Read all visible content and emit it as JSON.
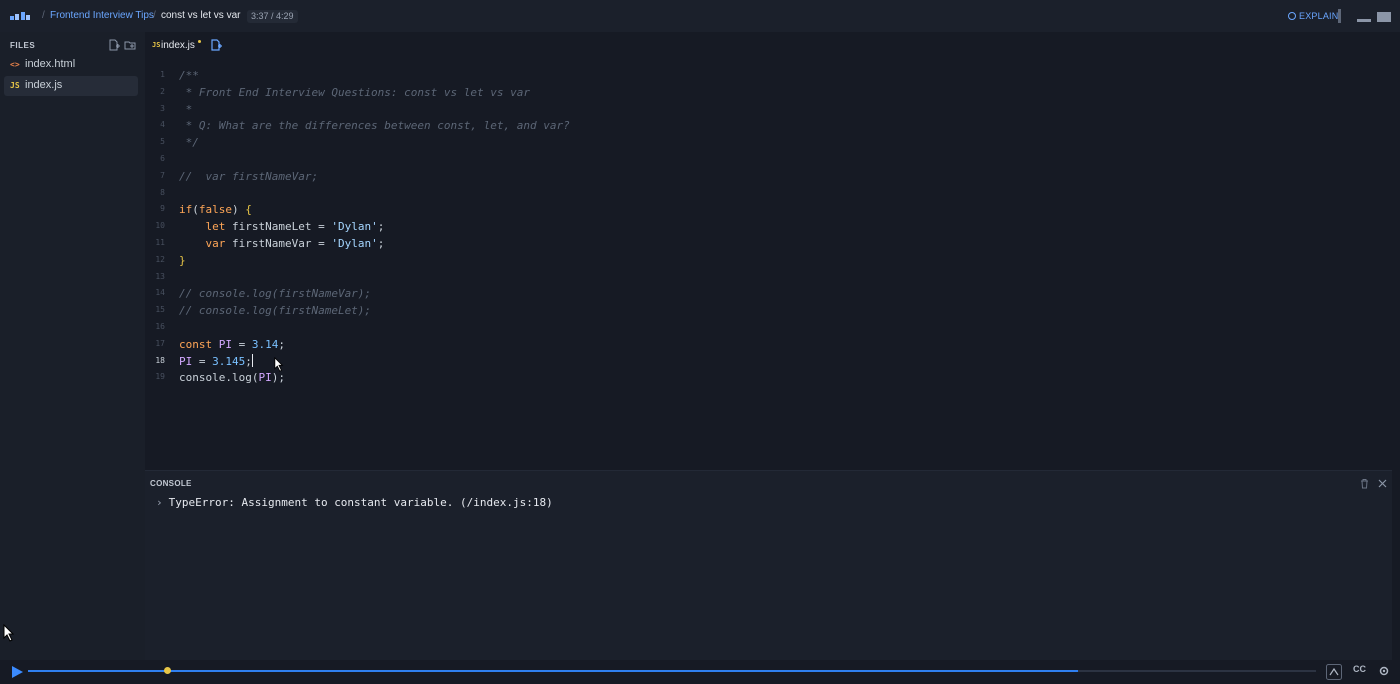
{
  "header": {
    "breadcrumb_sep": "/",
    "course": "Frontend Interview Tips",
    "title": "const vs let vs var",
    "time": "3:37 / 4:29",
    "explain_label": "EXPLAIN"
  },
  "sidebar": {
    "header": "FILES",
    "files": [
      {
        "icon": "<>",
        "name": "index.html",
        "icon_color": "#e8824a"
      },
      {
        "icon": "JS",
        "name": "index.js",
        "icon_color": "#e7c547",
        "active": true
      }
    ]
  },
  "editor": {
    "tab_icon": "JS",
    "tab_name": "index.js",
    "current_line": 18,
    "lines": [
      {
        "n": "1",
        "tokens": [
          [
            "comment",
            "/**"
          ]
        ]
      },
      {
        "n": "2",
        "tokens": [
          [
            "comment",
            " * Front End Interview Questions: const vs let vs var"
          ]
        ]
      },
      {
        "n": "3",
        "tokens": [
          [
            "comment",
            " *"
          ]
        ]
      },
      {
        "n": "4",
        "tokens": [
          [
            "comment",
            " * Q: What are the differences between const, let, and var?"
          ]
        ]
      },
      {
        "n": "5",
        "tokens": [
          [
            "comment",
            " */"
          ]
        ]
      },
      {
        "n": "6",
        "tokens": []
      },
      {
        "n": "7",
        "tokens": [
          [
            "comment",
            "//  var firstNameVar;"
          ]
        ]
      },
      {
        "n": "8",
        "tokens": []
      },
      {
        "n": "9",
        "tokens": [
          [
            "keyword",
            "if"
          ],
          [
            "plain",
            "("
          ],
          [
            "keyword",
            "false"
          ],
          [
            "plain",
            ") "
          ],
          [
            "brace",
            "{"
          ]
        ]
      },
      {
        "n": "10",
        "tokens": [
          [
            "plain",
            "    "
          ],
          [
            "keyword",
            "let"
          ],
          [
            "plain",
            " firstNameLet = "
          ],
          [
            "string",
            "'Dylan'"
          ],
          [
            "plain",
            ";"
          ]
        ]
      },
      {
        "n": "11",
        "tokens": [
          [
            "plain",
            "    "
          ],
          [
            "keyword",
            "var"
          ],
          [
            "plain",
            " firstNameVar = "
          ],
          [
            "string",
            "'Dylan'"
          ],
          [
            "plain",
            ";"
          ]
        ]
      },
      {
        "n": "12",
        "tokens": [
          [
            "brace",
            "}"
          ]
        ]
      },
      {
        "n": "13",
        "tokens": []
      },
      {
        "n": "14",
        "tokens": [
          [
            "comment",
            "// console.log(firstNameVar);"
          ]
        ]
      },
      {
        "n": "15",
        "tokens": [
          [
            "comment",
            "// console.log(firstNameLet);"
          ]
        ]
      },
      {
        "n": "16",
        "tokens": []
      },
      {
        "n": "17",
        "tokens": [
          [
            "keyword",
            "const"
          ],
          [
            "plain",
            " "
          ],
          [
            "var",
            "PI"
          ],
          [
            "plain",
            " = "
          ],
          [
            "number",
            "3.14"
          ],
          [
            "plain",
            ";"
          ]
        ]
      },
      {
        "n": "18",
        "tokens": [
          [
            "var",
            "PI"
          ],
          [
            "plain",
            " = "
          ],
          [
            "number",
            "3.145"
          ],
          [
            "plain",
            ";"
          ]
        ],
        "caret": true
      },
      {
        "n": "19",
        "tokens": [
          [
            "plain",
            "console.log("
          ],
          [
            "var",
            "PI"
          ],
          [
            "plain",
            ");"
          ]
        ]
      }
    ]
  },
  "console": {
    "title": "CONSOLE",
    "chevron": "›",
    "message": "TypeError: Assignment to constant variable. (/index.js:18)"
  },
  "player": {
    "played": 0.815,
    "buffered": 0.108,
    "cc_label": "CC"
  },
  "colors": {
    "accent": "#2f7ff0",
    "link": "#6aa6ff",
    "highlight": "#e7c547"
  },
  "icons": [
    "logo-icon",
    "explain-icon",
    "new-file-icon",
    "new-folder-icon",
    "trash-icon",
    "close-icon",
    "play-icon",
    "settings-icon",
    "speed-icon"
  ]
}
